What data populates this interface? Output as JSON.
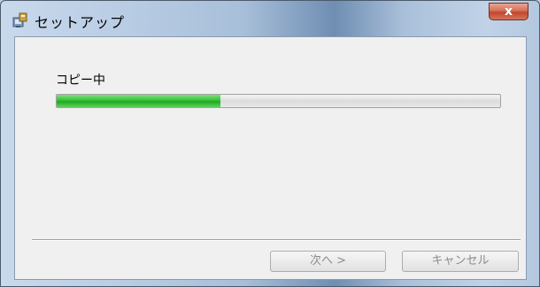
{
  "window": {
    "title": "セットアップ",
    "title_icon": "setup-installer-icon",
    "close_label": "x"
  },
  "content": {
    "status_label": "コピー中",
    "progress_fraction": 0.37,
    "progress_color": "#37c137"
  },
  "buttons": {
    "next_label": "次へ >",
    "cancel_label": "キャンセル",
    "next_enabled": false,
    "cancel_enabled": false
  }
}
